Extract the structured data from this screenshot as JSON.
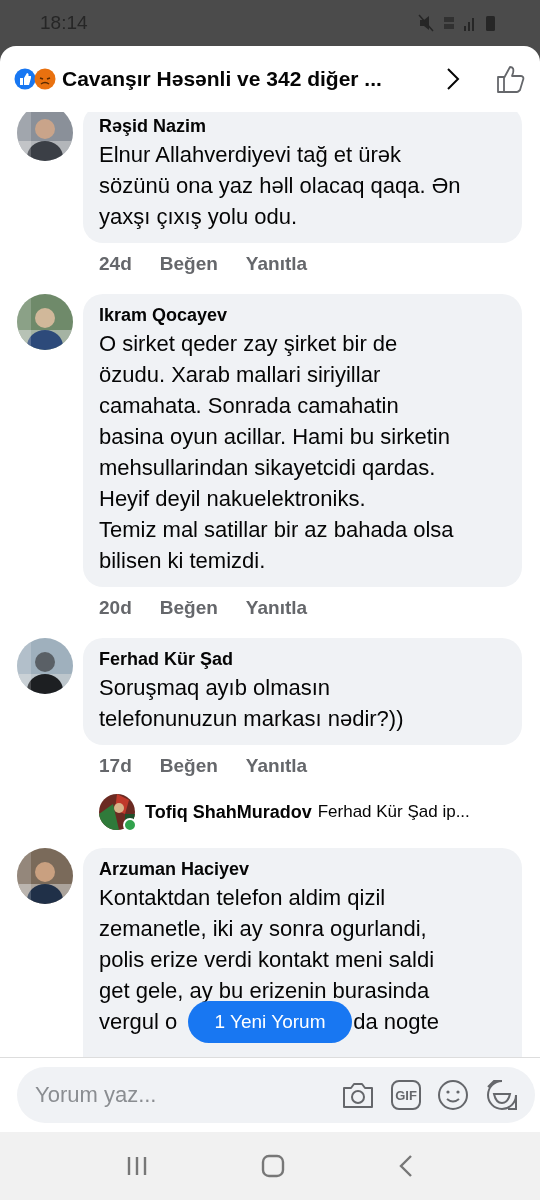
{
  "status_bar": {
    "time": "18:14"
  },
  "header": {
    "title": "Cavanşır Həsənli ve 342 diğer ..."
  },
  "comments": [
    {
      "name": "Rəşid Nazim",
      "lines": [
        "Elnur Allahverdiyevi tağ et ürək",
        "sözünü ona yaz həll olacaq qaqa. Ən",
        "yaxşı çıxış yolu odu."
      ],
      "time": "24d",
      "like": "Beğen",
      "reply": "Yanıtla"
    },
    {
      "name": "Ikram Qocayev",
      "lines": [
        "O sirket qeder zay şirket bir de",
        "özudu. Xarab mallari siriyillar",
        "camahata. Sonrada camahatin",
        "basina oyun acillar. Hami bu sirketin",
        "mehsullarindan sikayetcidi qardas.",
        "Heyif deyil nakuelektroniks.",
        "Temiz mal satillar bir az bahada olsa",
        "bilisen ki temizdi."
      ],
      "time": "20d",
      "like": "Beğen",
      "reply": "Yanıtla"
    },
    {
      "name": "Ferhad Kür Şad",
      "lines": [
        "Soruşmaq ayıb olmasın",
        "telefonunuzun markası nədir?))"
      ],
      "time": "17d",
      "like": "Beğen",
      "reply": "Yanıtla",
      "reply_preview": {
        "name": "Tofiq ShahMuradov",
        "text": "Ferhad Kür Şad ip...",
        "online": true
      }
    },
    {
      "name": "Arzuman Haciyev",
      "lines": [
        "Kontaktdan telefon aldim qizil",
        "zemanetle, iki ay sonra ogurlandi,",
        "polis erize verdi kontakt meni saldi",
        "get gele, ay bu erizenin burasinda",
        [
          "vergul o",
          "da nogte"
        ]
      ]
    }
  ],
  "new_comments": {
    "label": "1 Yeni Yorum"
  },
  "composer": {
    "placeholder": "Yorum yaz...",
    "gif": "GIF"
  }
}
